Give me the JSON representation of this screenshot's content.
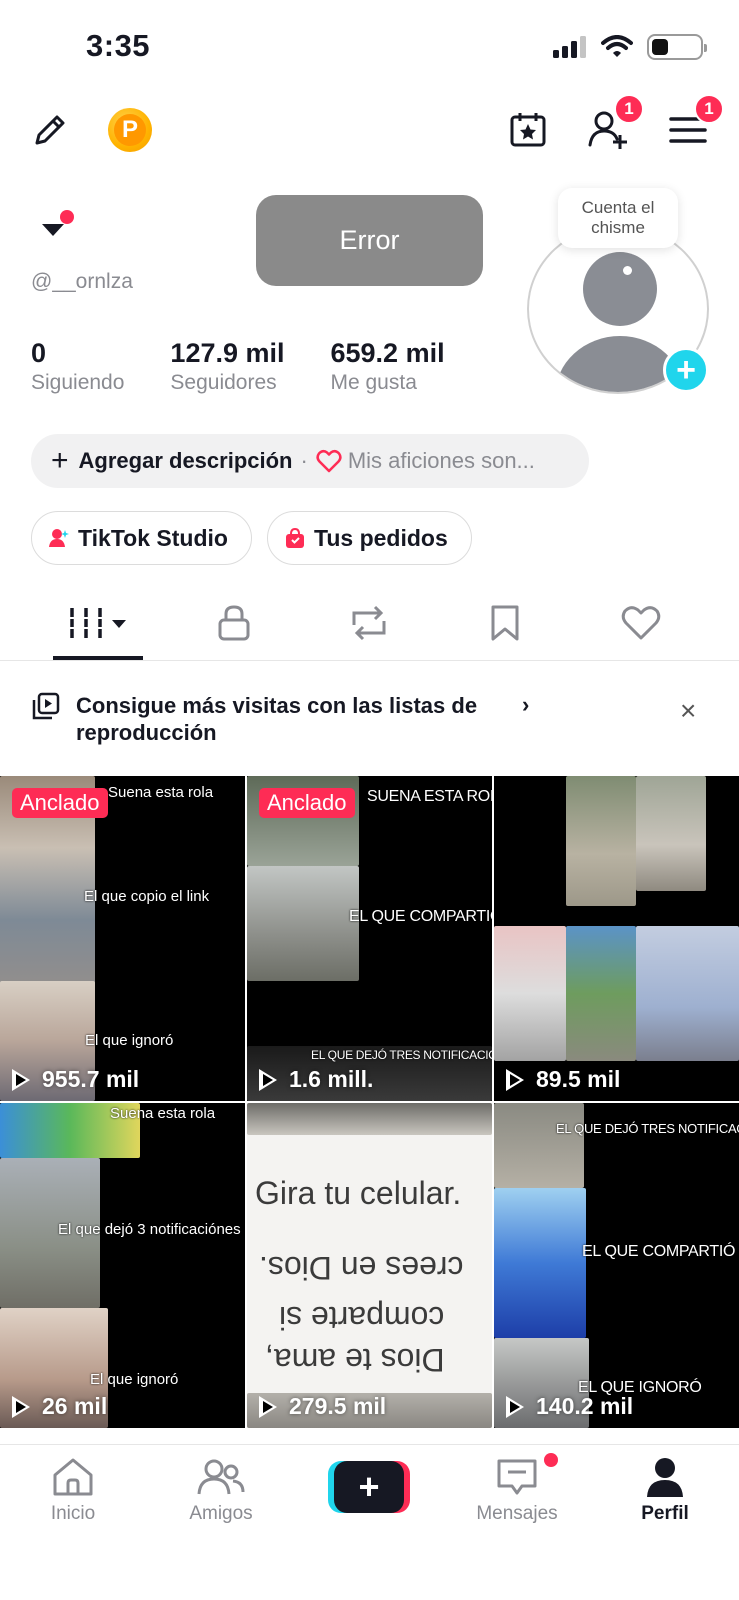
{
  "status_bar": {
    "time": "3:35"
  },
  "header": {
    "coin_letter": "P",
    "add_friends_badge": "1",
    "menu_badge": "1"
  },
  "profile": {
    "handle": "@__ornlza",
    "toast": "Error",
    "bubble": "Cuenta el chisme",
    "stats": [
      {
        "value": "0",
        "label": "Siguiendo"
      },
      {
        "value": "127.9 mil",
        "label": "Seguidores"
      },
      {
        "value": "659.2 mil",
        "label": "Me gusta"
      }
    ],
    "description": {
      "add": "Agregar descripción",
      "separator": "·",
      "hint": "Mis aficiones son..."
    },
    "chips": [
      {
        "label": "TikTok Studio",
        "icon": "studio-icon"
      },
      {
        "label": "Tus pedidos",
        "icon": "shopping-bag-icon"
      }
    ],
    "avatar_plus": "+"
  },
  "tabs": [
    {
      "name": "videos",
      "icon": "grid-icon"
    },
    {
      "name": "private",
      "icon": "lock-icon"
    },
    {
      "name": "reposts",
      "icon": "repost-icon"
    },
    {
      "name": "favorites",
      "icon": "bookmark-icon"
    },
    {
      "name": "liked",
      "icon": "heart-icon"
    }
  ],
  "banner": {
    "text": "Consigue más visitas con las listas de reproducción",
    "chevron": "›",
    "close": "×"
  },
  "videos": [
    {
      "pinned": "Anclado",
      "views": "955.7 mil",
      "captions": [
        "Suena esta rola",
        "El que copio el link",
        "El que ignoró"
      ]
    },
    {
      "pinned": "Anclado",
      "views": "1.6 mill.",
      "captions": [
        "SUENA ESTA ROLA",
        "EL QUE COMPARTIÓ",
        "EL QUE DEJÓ TRES NOTIFICACIONES"
      ]
    },
    {
      "pinned": "",
      "views": "89.5 mil",
      "captions": []
    },
    {
      "pinned": "",
      "views": "26 mil",
      "captions": [
        "Suena esta rola",
        "El que dejó 3 notificaciónes",
        "El que ignoró"
      ]
    },
    {
      "pinned": "",
      "views": "279.5 mil",
      "captions": [
        "Gira tu celular.",
        "crees en Dios.",
        "comparte si",
        "Dios te ama,"
      ]
    },
    {
      "pinned": "",
      "views": "140.2 mil",
      "captions": [
        "EL QUE DEJÓ TRES NOTIFICACIONES",
        "EL QUE COMPARTIÓ",
        "EL QUE IGNORÓ"
      ]
    }
  ],
  "bottom_nav": [
    {
      "label": "Inicio"
    },
    {
      "label": "Amigos"
    },
    {
      "label": "Mensajes"
    },
    {
      "label": "Perfil"
    }
  ],
  "create_plus": "+",
  "colors": {
    "accent": "#fe2c55",
    "cyan": "#20d5ec",
    "text": "#161823",
    "muted": "#8a8b91"
  }
}
